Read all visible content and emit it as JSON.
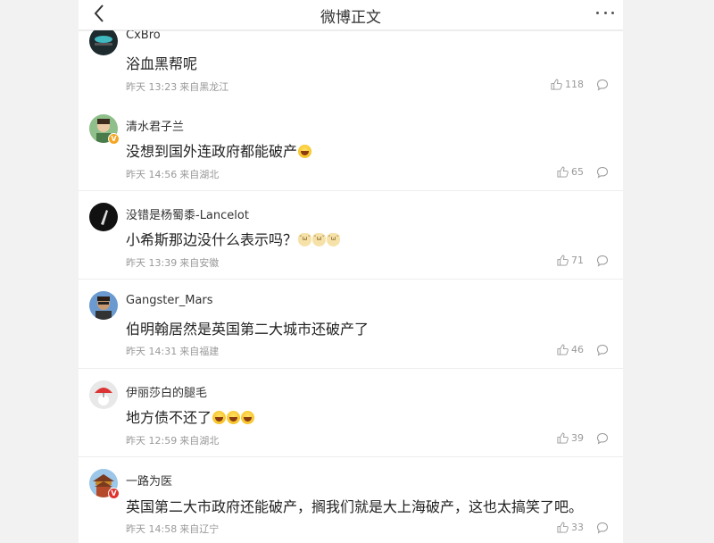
{
  "nav": {
    "title": "微博正文"
  },
  "comments": [
    {
      "name": "CxBro",
      "text": "浴血黑帮呢",
      "time": "昨天 13:23",
      "location": "来自黑龙江",
      "likes": "118",
      "verified": false,
      "emoji": []
    },
    {
      "name": "清水君子兰",
      "text": "没想到国外连政府都能破产",
      "time": "昨天 14:56",
      "location": "来自湖北",
      "likes": "65",
      "verified": true,
      "emoji": [
        "laugh"
      ]
    },
    {
      "name": "没错是杨蜀黍-Lancelot",
      "text": "小希斯那边没什么表示吗？",
      "time": "昨天 13:39",
      "location": "来自安徽",
      "likes": "71",
      "verified": false,
      "emoji": [
        "cat",
        "cat",
        "cat"
      ]
    },
    {
      "name": "Gangster_Mars",
      "text": "伯明翰居然是英国第二大城市还破产了",
      "time": "昨天 14:31",
      "location": "来自福建",
      "likes": "46",
      "verified": false,
      "emoji": []
    },
    {
      "name": "伊丽莎白的腿毛",
      "text": "地方债不还了",
      "time": "昨天 12:59",
      "location": "来自湖北",
      "likes": "39",
      "verified": false,
      "emoji": [
        "laugh",
        "laugh",
        "laugh"
      ]
    },
    {
      "name": "一路为医",
      "text": "英国第二大市政府还能破产，搁我们就是大上海破产，这也太搞笑了吧。",
      "time": "昨天 14:58",
      "location": "来自辽宁",
      "likes": "33",
      "verified": true,
      "emoji": []
    }
  ],
  "colors": {
    "verified_badge": "#f5a623",
    "verified_badge_red": "#e0332e",
    "meta": "#999999"
  }
}
